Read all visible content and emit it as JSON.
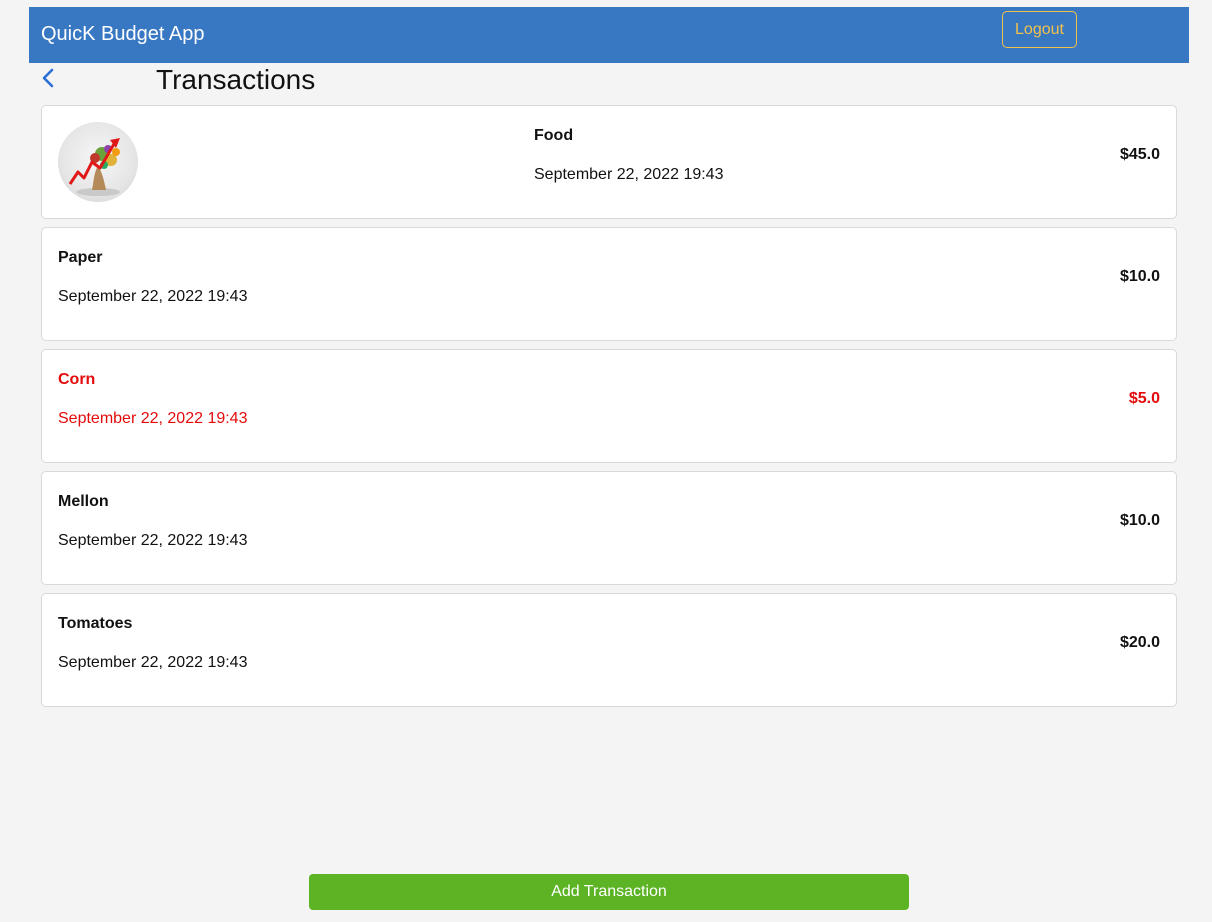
{
  "header": {
    "brand": "QuicK Budget App",
    "logout_label": "Logout",
    "bar_color": "#3878c3",
    "logout_color": "#f2c14a"
  },
  "page": {
    "title": "Transactions",
    "back_icon": "chevron-left-icon"
  },
  "transactions": [
    {
      "name": "Food",
      "date": "September 22, 2022 19:43",
      "amount": "$45.0",
      "has_image": true,
      "image": "food-growth-image",
      "color": "#000000"
    },
    {
      "name": "Paper",
      "date": "September 22, 2022 19:43",
      "amount": "$10.0",
      "has_image": false,
      "color": "#000000"
    },
    {
      "name": "Corn",
      "date": "September 22, 2022 19:43",
      "amount": "$5.0",
      "has_image": false,
      "color": "#e30b0b"
    },
    {
      "name": "Mellon",
      "date": "September 22, 2022 19:43",
      "amount": "$10.0",
      "has_image": false,
      "color": "#000000"
    },
    {
      "name": "Tomatoes",
      "date": "September 22, 2022 19:43",
      "amount": "$20.0",
      "has_image": false,
      "color": "#000000"
    }
  ],
  "footer": {
    "add_label": "Add Transaction",
    "add_color": "#5cb424"
  }
}
